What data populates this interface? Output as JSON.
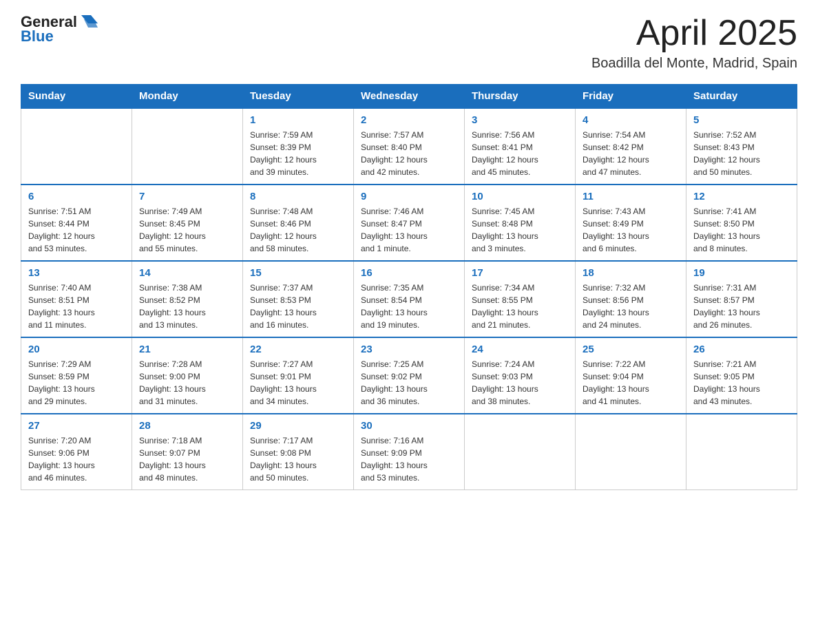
{
  "header": {
    "logo": {
      "general": "General",
      "blue": "Blue"
    },
    "title": "April 2025",
    "location": "Boadilla del Monte, Madrid, Spain"
  },
  "calendar": {
    "days_of_week": [
      "Sunday",
      "Monday",
      "Tuesday",
      "Wednesday",
      "Thursday",
      "Friday",
      "Saturday"
    ],
    "weeks": [
      [
        {
          "day": "",
          "info": ""
        },
        {
          "day": "",
          "info": ""
        },
        {
          "day": "1",
          "info": "Sunrise: 7:59 AM\nSunset: 8:39 PM\nDaylight: 12 hours\nand 39 minutes."
        },
        {
          "day": "2",
          "info": "Sunrise: 7:57 AM\nSunset: 8:40 PM\nDaylight: 12 hours\nand 42 minutes."
        },
        {
          "day": "3",
          "info": "Sunrise: 7:56 AM\nSunset: 8:41 PM\nDaylight: 12 hours\nand 45 minutes."
        },
        {
          "day": "4",
          "info": "Sunrise: 7:54 AM\nSunset: 8:42 PM\nDaylight: 12 hours\nand 47 minutes."
        },
        {
          "day": "5",
          "info": "Sunrise: 7:52 AM\nSunset: 8:43 PM\nDaylight: 12 hours\nand 50 minutes."
        }
      ],
      [
        {
          "day": "6",
          "info": "Sunrise: 7:51 AM\nSunset: 8:44 PM\nDaylight: 12 hours\nand 53 minutes."
        },
        {
          "day": "7",
          "info": "Sunrise: 7:49 AM\nSunset: 8:45 PM\nDaylight: 12 hours\nand 55 minutes."
        },
        {
          "day": "8",
          "info": "Sunrise: 7:48 AM\nSunset: 8:46 PM\nDaylight: 12 hours\nand 58 minutes."
        },
        {
          "day": "9",
          "info": "Sunrise: 7:46 AM\nSunset: 8:47 PM\nDaylight: 13 hours\nand 1 minute."
        },
        {
          "day": "10",
          "info": "Sunrise: 7:45 AM\nSunset: 8:48 PM\nDaylight: 13 hours\nand 3 minutes."
        },
        {
          "day": "11",
          "info": "Sunrise: 7:43 AM\nSunset: 8:49 PM\nDaylight: 13 hours\nand 6 minutes."
        },
        {
          "day": "12",
          "info": "Sunrise: 7:41 AM\nSunset: 8:50 PM\nDaylight: 13 hours\nand 8 minutes."
        }
      ],
      [
        {
          "day": "13",
          "info": "Sunrise: 7:40 AM\nSunset: 8:51 PM\nDaylight: 13 hours\nand 11 minutes."
        },
        {
          "day": "14",
          "info": "Sunrise: 7:38 AM\nSunset: 8:52 PM\nDaylight: 13 hours\nand 13 minutes."
        },
        {
          "day": "15",
          "info": "Sunrise: 7:37 AM\nSunset: 8:53 PM\nDaylight: 13 hours\nand 16 minutes."
        },
        {
          "day": "16",
          "info": "Sunrise: 7:35 AM\nSunset: 8:54 PM\nDaylight: 13 hours\nand 19 minutes."
        },
        {
          "day": "17",
          "info": "Sunrise: 7:34 AM\nSunset: 8:55 PM\nDaylight: 13 hours\nand 21 minutes."
        },
        {
          "day": "18",
          "info": "Sunrise: 7:32 AM\nSunset: 8:56 PM\nDaylight: 13 hours\nand 24 minutes."
        },
        {
          "day": "19",
          "info": "Sunrise: 7:31 AM\nSunset: 8:57 PM\nDaylight: 13 hours\nand 26 minutes."
        }
      ],
      [
        {
          "day": "20",
          "info": "Sunrise: 7:29 AM\nSunset: 8:59 PM\nDaylight: 13 hours\nand 29 minutes."
        },
        {
          "day": "21",
          "info": "Sunrise: 7:28 AM\nSunset: 9:00 PM\nDaylight: 13 hours\nand 31 minutes."
        },
        {
          "day": "22",
          "info": "Sunrise: 7:27 AM\nSunset: 9:01 PM\nDaylight: 13 hours\nand 34 minutes."
        },
        {
          "day": "23",
          "info": "Sunrise: 7:25 AM\nSunset: 9:02 PM\nDaylight: 13 hours\nand 36 minutes."
        },
        {
          "day": "24",
          "info": "Sunrise: 7:24 AM\nSunset: 9:03 PM\nDaylight: 13 hours\nand 38 minutes."
        },
        {
          "day": "25",
          "info": "Sunrise: 7:22 AM\nSunset: 9:04 PM\nDaylight: 13 hours\nand 41 minutes."
        },
        {
          "day": "26",
          "info": "Sunrise: 7:21 AM\nSunset: 9:05 PM\nDaylight: 13 hours\nand 43 minutes."
        }
      ],
      [
        {
          "day": "27",
          "info": "Sunrise: 7:20 AM\nSunset: 9:06 PM\nDaylight: 13 hours\nand 46 minutes."
        },
        {
          "day": "28",
          "info": "Sunrise: 7:18 AM\nSunset: 9:07 PM\nDaylight: 13 hours\nand 48 minutes."
        },
        {
          "day": "29",
          "info": "Sunrise: 7:17 AM\nSunset: 9:08 PM\nDaylight: 13 hours\nand 50 minutes."
        },
        {
          "day": "30",
          "info": "Sunrise: 7:16 AM\nSunset: 9:09 PM\nDaylight: 13 hours\nand 53 minutes."
        },
        {
          "day": "",
          "info": ""
        },
        {
          "day": "",
          "info": ""
        },
        {
          "day": "",
          "info": ""
        }
      ]
    ]
  }
}
